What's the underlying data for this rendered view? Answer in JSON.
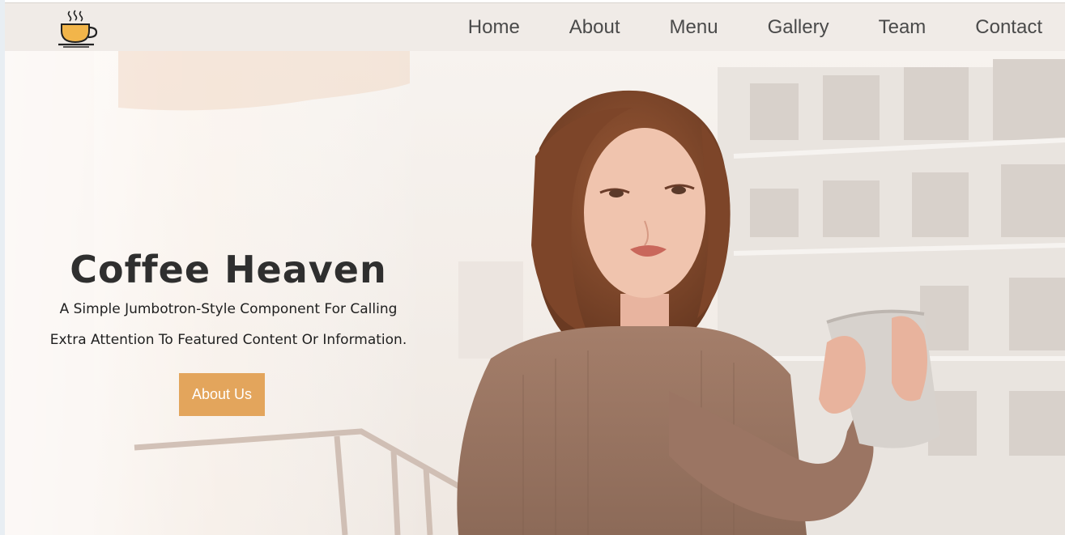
{
  "brand": {
    "logo_icon": "coffee-cup-icon",
    "accent_color": "#e3a55c"
  },
  "nav": {
    "items": [
      {
        "label": "Home"
      },
      {
        "label": "About"
      },
      {
        "label": "Menu"
      },
      {
        "label": "Gallery"
      },
      {
        "label": "Team"
      },
      {
        "label": "Contact"
      }
    ]
  },
  "hero": {
    "title": "Coffee Heaven",
    "subtitle_line1": "A Simple Jumbotron-Style Component For Calling",
    "subtitle_line2": "Extra Attention To Featured Content Or Information.",
    "button_label": "About Us"
  }
}
